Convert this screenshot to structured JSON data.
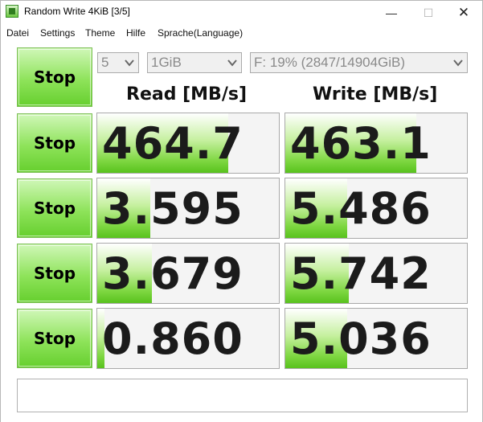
{
  "window": {
    "title": "Random Write 4KiB [3/5]",
    "minimize_glyph": "—",
    "maximize_glyph": "☐",
    "close_glyph": "✕"
  },
  "menu": {
    "file": "Datei",
    "settings": "Settings",
    "theme": "Theme",
    "help": "Hilfe",
    "language": "Sprache(Language)"
  },
  "controls": {
    "all_button": "Stop",
    "count_value": "5",
    "size_value": "1GiB",
    "drive_value": "F: 19% (2847/14904GiB)"
  },
  "headers": {
    "read": "Read [MB/s]",
    "write": "Write [MB/s]"
  },
  "rows": [
    {
      "button": "Stop",
      "read": "464.7",
      "write": "463.1",
      "read_fill": 0.72,
      "write_fill": 0.72
    },
    {
      "button": "Stop",
      "read": "3.595",
      "write": "5.486",
      "read_fill": 0.29,
      "write_fill": 0.34
    },
    {
      "button": "Stop",
      "read": "3.679",
      "write": "5.742",
      "read_fill": 0.3,
      "write_fill": 0.35
    },
    {
      "button": "Stop",
      "read": "0.860",
      "write": "5.036",
      "read_fill": 0.04,
      "write_fill": 0.34
    }
  ],
  "comment": "",
  "colors": {
    "accent_green": "#66cf2e",
    "fill_green": "#58c21d"
  }
}
